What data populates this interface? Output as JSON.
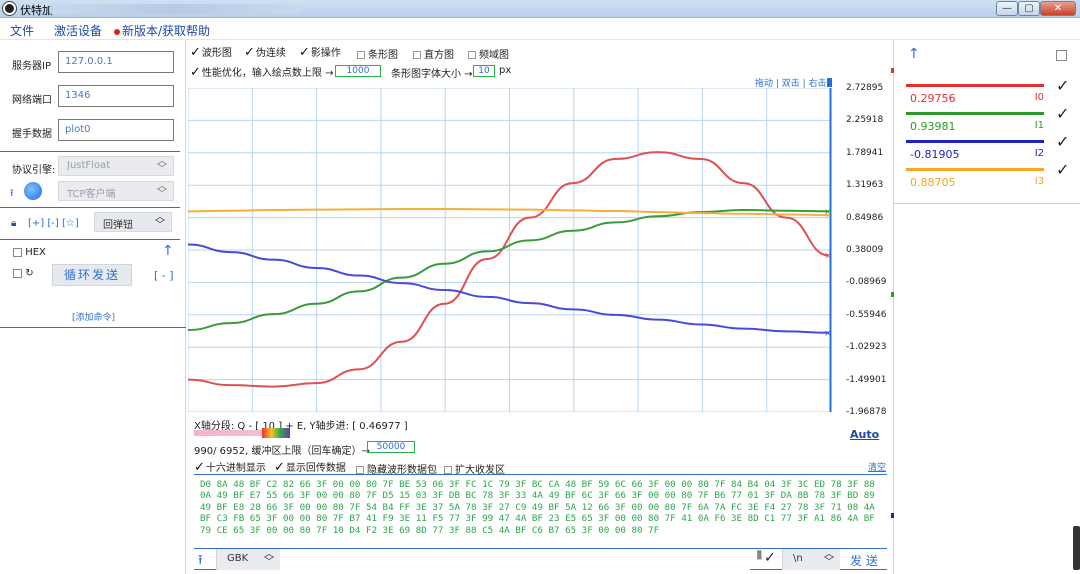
{
  "window": {
    "title": "伏特加",
    "min_label": "—",
    "max_label": "▢",
    "close_label": "✕"
  },
  "menu": {
    "file": "文件",
    "activate": "激活设备",
    "update": "新版本/获取帮助"
  },
  "left": {
    "server_ip_label": "服务器IP",
    "server_ip_value": "127.0.0.1",
    "port_label": "网络端口",
    "port_value": "1346",
    "handshake_label": "握手数据",
    "handshake_value": "plot0",
    "protocol_label": "协议引擎:",
    "protocol_value": "JustFloat",
    "conn_mode_value": "TCP客户端",
    "lock_links": "[+]  [-]  [☆]",
    "popup_button": "回弹钮",
    "hex_label": "HEX",
    "loop_send": "循环发送",
    "minus_link": "[ - ]",
    "add_command": "[添加命令]"
  },
  "toolbar": {
    "waveform": "波形图",
    "pseudo_connect": "伪连续",
    "shadow_op": "影操作",
    "bar": "条形图",
    "histogram": "直方图",
    "freq": "频域图",
    "perf_opt": "性能优化，输入绘点数上限 →",
    "perf_limit": "1000",
    "bar_font": "条形图字体大小 →",
    "bar_font_size": "10",
    "px": "px",
    "plot_links": "拖动 | 双击 | 右击"
  },
  "axis": {
    "y_ticks": [
      "2.72895",
      "2.25918",
      "1.78941",
      "1.31963",
      "0.84986",
      "0.38009",
      "-0.08969",
      "-0.55946",
      "-1.02923",
      "-1.49901",
      "-1.96878"
    ]
  },
  "status": {
    "x_seg": "X轴分段:  Q - [ 10 ] + E,   Y轴步进: [ 0.46977 ]",
    "buffer": "990/ 6952,  缓冲区上限（回车确定）→",
    "buffer_value": "50000",
    "auto": "Auto"
  },
  "rx": {
    "hex_show": "十六进制显示",
    "show_echo": "显示回传数据",
    "hide_packet": "隐藏波形数据包",
    "expand": "扩大收发区",
    "clear": "清空",
    "hex_data": "D0 8A 48 BF C2 82 66 3F 00 00 80 7F BE 53 06 3F FC 1C 79 3F BC CA 48 BF 59 6C 66 3F 00 00 80 7F 84 B4 04 3F 3C ED 78 3F 88 0A 49 BF E7 55 66 3F 00 00 80 7F D5 15 03 3F DB BC 78 3F 33 4A 49 BF 6C 3F 66 3F 00 00 80 7F B6 77 01 3F DA 8B 78 3F BD 89 49 BF E8 28 66 3F 00 00 80 7F 54 B4 FF 3E 37 5A 78 3F 27 C9 49 BF 5A 12 66 3F 00 00 80 7F 6A 7A FC 3E F4 27 78 3F 71 08 4A BF C3 FB 65 3F 00 00 80 7F B7 41 F9 3E 11 F5 77 3F 99 47 4A BF 23 E5 65 3F 00 00 80 7F 41 0A F6 3E 8D C1 77 3F A1 86 4A BF 79 CE 65 3F 00 00 80 7F 10 D4 F2 3E 69 8D 77 3F 88 C5 4A BF C6 B7 65 3F 00 00 80 7F"
  },
  "tx": {
    "encoding": "GBK",
    "line_end": "\\n",
    "send": "发 送"
  },
  "legend": {
    "items": [
      {
        "value": "0.29756",
        "name": "I0",
        "color": "#e03030"
      },
      {
        "value": "0.93981",
        "name": "I1",
        "color": "#2a9a2a"
      },
      {
        "value": "-0.81905",
        "name": "I2",
        "color": "#2020c8"
      },
      {
        "value": "0.88705",
        "name": "I3",
        "color": "#f5a623"
      }
    ]
  },
  "chart_data": {
    "type": "line",
    "ylim": [
      -1.96878,
      2.72895
    ],
    "grid": true,
    "series": [
      {
        "name": "I0",
        "color": "#e05050",
        "values": [
          -1.5,
          -1.58,
          -1.6,
          -1.55,
          -1.35,
          -0.95,
          -0.4,
          0.25,
          0.85,
          1.35,
          1.7,
          1.8,
          1.7,
          1.35,
          0.85,
          0.3
        ]
      },
      {
        "name": "I1",
        "color": "#3a9a3a",
        "values": [
          -0.78,
          -0.68,
          -0.55,
          -0.4,
          -0.22,
          -0.02,
          0.18,
          0.36,
          0.52,
          0.66,
          0.78,
          0.87,
          0.93,
          0.96,
          0.95,
          0.94
        ]
      },
      {
        "name": "I2",
        "color": "#4a4ad8",
        "values": [
          0.46,
          0.35,
          0.24,
          0.12,
          0.01,
          -0.1,
          -0.2,
          -0.3,
          -0.39,
          -0.48,
          -0.56,
          -0.63,
          -0.7,
          -0.76,
          -0.8,
          -0.82
        ]
      },
      {
        "name": "I3",
        "color": "#f5b040",
        "values": [
          0.94,
          0.95,
          0.96,
          0.965,
          0.97,
          0.975,
          0.975,
          0.97,
          0.965,
          0.955,
          0.945,
          0.93,
          0.915,
          0.905,
          0.895,
          0.887
        ]
      }
    ]
  }
}
